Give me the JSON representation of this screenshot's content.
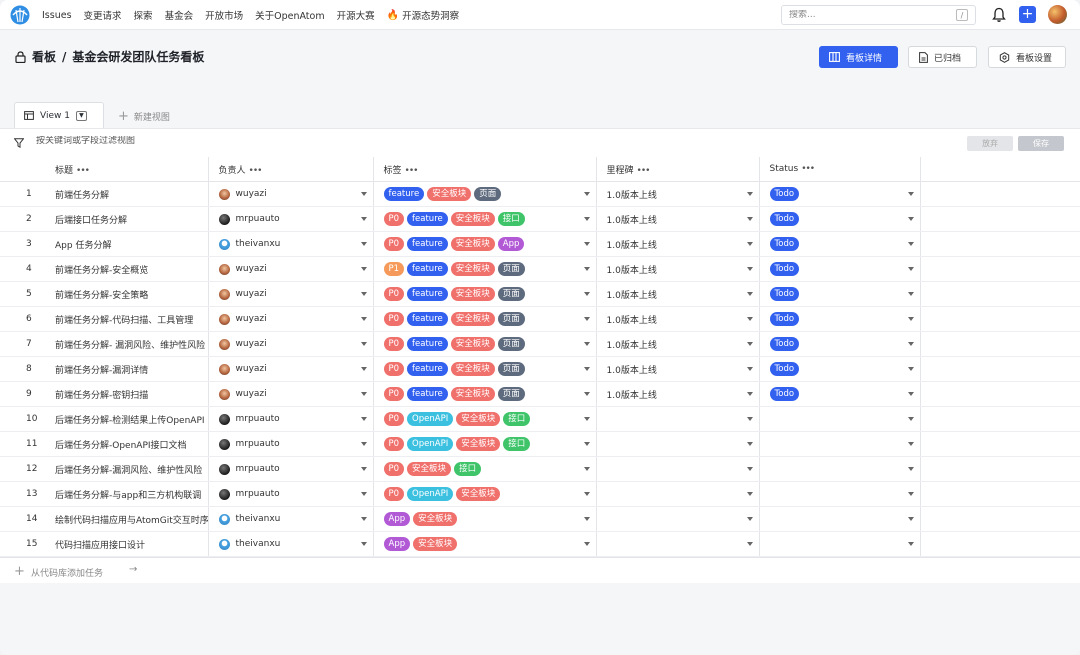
{
  "nav": {
    "items": [
      "Issues",
      "变更请求",
      "探索",
      "基金会",
      "开放市场",
      "关于OpenAtom",
      "开源大赛",
      "开源态势洞察"
    ],
    "search_placeholder": "搜索...",
    "search_key": "/",
    "add_label": "+",
    "brand_color": "#3261f0"
  },
  "board": {
    "breadcrumb_root": "看板",
    "breadcrumb_sep": "/",
    "title": "基金会研发团队任务看板",
    "btn_details": "看板详情",
    "btn_archived": "已归档",
    "btn_settings": "看板设置"
  },
  "tabs": {
    "active": "View 1",
    "new_view": "新建视图"
  },
  "filter": {
    "placeholder": "按关键词或字段过滤视图",
    "discard": "放弃",
    "save": "保存"
  },
  "columns": {
    "title": "标题",
    "owner": "负责人",
    "tags": "标签",
    "milestone": "里程碑",
    "status": "Status",
    "more": "•••"
  },
  "tag_colors": {
    "feature": "#3261f0",
    "安全板块": "#f0706c",
    "页面": "#5e6b7e",
    "P0": "#f0706c",
    "P1": "#f59a5a",
    "接口": "#3fc46a",
    "App": "#b25ad6",
    "OpenAPI": "#3cc0e0"
  },
  "status_color": "#3261f0",
  "rows": [
    {
      "idx": "1",
      "title": "前端任务分解",
      "owner": "wuyazi",
      "avatar": "wuyazi",
      "tags": [
        "feature",
        "安全板块",
        "页面"
      ],
      "milestone": "1.0版本上线",
      "status": "Todo"
    },
    {
      "idx": "2",
      "title": "后端接口任务分解",
      "owner": "mrpuauto",
      "avatar": "mrpuauto",
      "tags": [
        "P0",
        "feature",
        "安全板块",
        "接口"
      ],
      "milestone": "1.0版本上线",
      "status": "Todo"
    },
    {
      "idx": "3",
      "title": "App 任务分解",
      "owner": "theivanxu",
      "avatar": "theivanxu",
      "tags": [
        "P0",
        "feature",
        "安全板块",
        "App"
      ],
      "milestone": "1.0版本上线",
      "status": "Todo"
    },
    {
      "idx": "4",
      "title": "前端任务分解-安全概览",
      "owner": "wuyazi",
      "avatar": "wuyazi",
      "tags": [
        "P1",
        "feature",
        "安全板块",
        "页面"
      ],
      "milestone": "1.0版本上线",
      "status": "Todo"
    },
    {
      "idx": "5",
      "title": "前端任务分解-安全策略",
      "owner": "wuyazi",
      "avatar": "wuyazi",
      "tags": [
        "P0",
        "feature",
        "安全板块",
        "页面"
      ],
      "milestone": "1.0版本上线",
      "status": "Todo"
    },
    {
      "idx": "6",
      "title": "前端任务分解-代码扫描、工具管理",
      "owner": "wuyazi",
      "avatar": "wuyazi",
      "tags": [
        "P0",
        "feature",
        "安全板块",
        "页面"
      ],
      "milestone": "1.0版本上线",
      "status": "Todo"
    },
    {
      "idx": "7",
      "title": "前端任务分解- 漏洞风险、维护性风险",
      "owner": "wuyazi",
      "avatar": "wuyazi",
      "tags": [
        "P0",
        "feature",
        "安全板块",
        "页面"
      ],
      "milestone": "1.0版本上线",
      "status": "Todo"
    },
    {
      "idx": "8",
      "title": "前端任务分解-漏洞详情",
      "owner": "wuyazi",
      "avatar": "wuyazi",
      "tags": [
        "P0",
        "feature",
        "安全板块",
        "页面"
      ],
      "milestone": "1.0版本上线",
      "status": "Todo"
    },
    {
      "idx": "9",
      "title": "前端任务分解-密钥扫描",
      "owner": "wuyazi",
      "avatar": "wuyazi",
      "tags": [
        "P0",
        "feature",
        "安全板块",
        "页面"
      ],
      "milestone": "1.0版本上线",
      "status": "Todo"
    },
    {
      "idx": "10",
      "title": "后端任务分解-检测结果上传OpenAPI",
      "owner": "mrpuauto",
      "avatar": "mrpuauto",
      "tags": [
        "P0",
        "OpenAPI",
        "安全板块",
        "接口"
      ],
      "milestone": "",
      "status": ""
    },
    {
      "idx": "11",
      "title": "后端任务分解-OpenAPI接口文档",
      "owner": "mrpuauto",
      "avatar": "mrpuauto",
      "tags": [
        "P0",
        "OpenAPI",
        "安全板块",
        "接口"
      ],
      "milestone": "",
      "status": ""
    },
    {
      "idx": "12",
      "title": "后端任务分解-漏洞风险、维护性风险",
      "owner": "mrpuauto",
      "avatar": "mrpuauto",
      "tags": [
        "P0",
        "安全板块",
        "接口"
      ],
      "milestone": "",
      "status": ""
    },
    {
      "idx": "13",
      "title": "后端任务分解-与app和三方机构联调",
      "owner": "mrpuauto",
      "avatar": "mrpuauto",
      "tags": [
        "P0",
        "OpenAPI",
        "安全板块"
      ],
      "milestone": "",
      "status": ""
    },
    {
      "idx": "14",
      "title": "绘制代码扫描应用与AtomGit交互时序",
      "owner": "theivanxu",
      "avatar": "theivanxu",
      "tags": [
        "App",
        "安全板块"
      ],
      "milestone": "",
      "status": ""
    },
    {
      "idx": "15",
      "title": "代码扫描应用接口设计",
      "owner": "theivanxu",
      "avatar": "theivanxu",
      "tags": [
        "App",
        "安全板块"
      ],
      "milestone": "",
      "status": ""
    }
  ],
  "add_row": {
    "label": "从代码库添加任务",
    "arrow": "→"
  }
}
